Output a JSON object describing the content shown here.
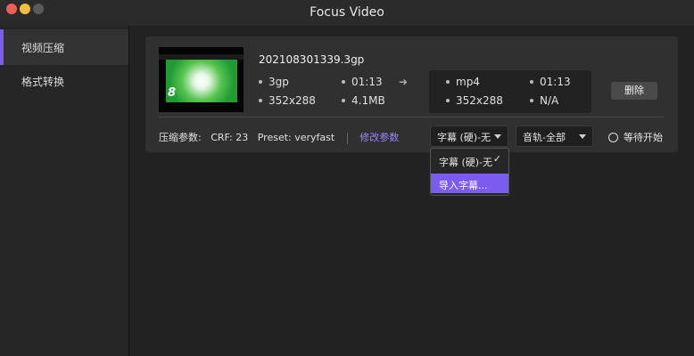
{
  "window": {
    "title": "Focus Video"
  },
  "sidebar": {
    "items": [
      {
        "label": "视频压缩",
        "active": true
      },
      {
        "label": "格式转换",
        "active": false
      }
    ]
  },
  "file": {
    "name": "202108301339.3gp",
    "thumbnail_text": "8",
    "source": {
      "format": "3gp",
      "duration": "01:13",
      "resolution": "352x288",
      "size": "4.1MB"
    },
    "output": {
      "format": "mp4",
      "duration": "01:13",
      "resolution": "352x288",
      "size": "N/A"
    },
    "delete_label": "删除"
  },
  "params": {
    "label": "压缩参数:",
    "crf": "CRF: 23",
    "preset": "Preset: veryfast",
    "modify_label": "修改参数"
  },
  "subtitle_select": {
    "value": "字幕 (硬)-无"
  },
  "audio_select": {
    "value": "音轨-全部"
  },
  "start_button": {
    "label": "等待开始"
  },
  "subtitle_dropdown": {
    "items": [
      {
        "label": "字幕 (硬)-无",
        "checked": true
      },
      {
        "label": "导入字幕...",
        "highlighted": true
      }
    ]
  },
  "colors": {
    "accent": "#7b5cf0",
    "close": "#ec5f57",
    "minimize": "#f3be3b"
  }
}
